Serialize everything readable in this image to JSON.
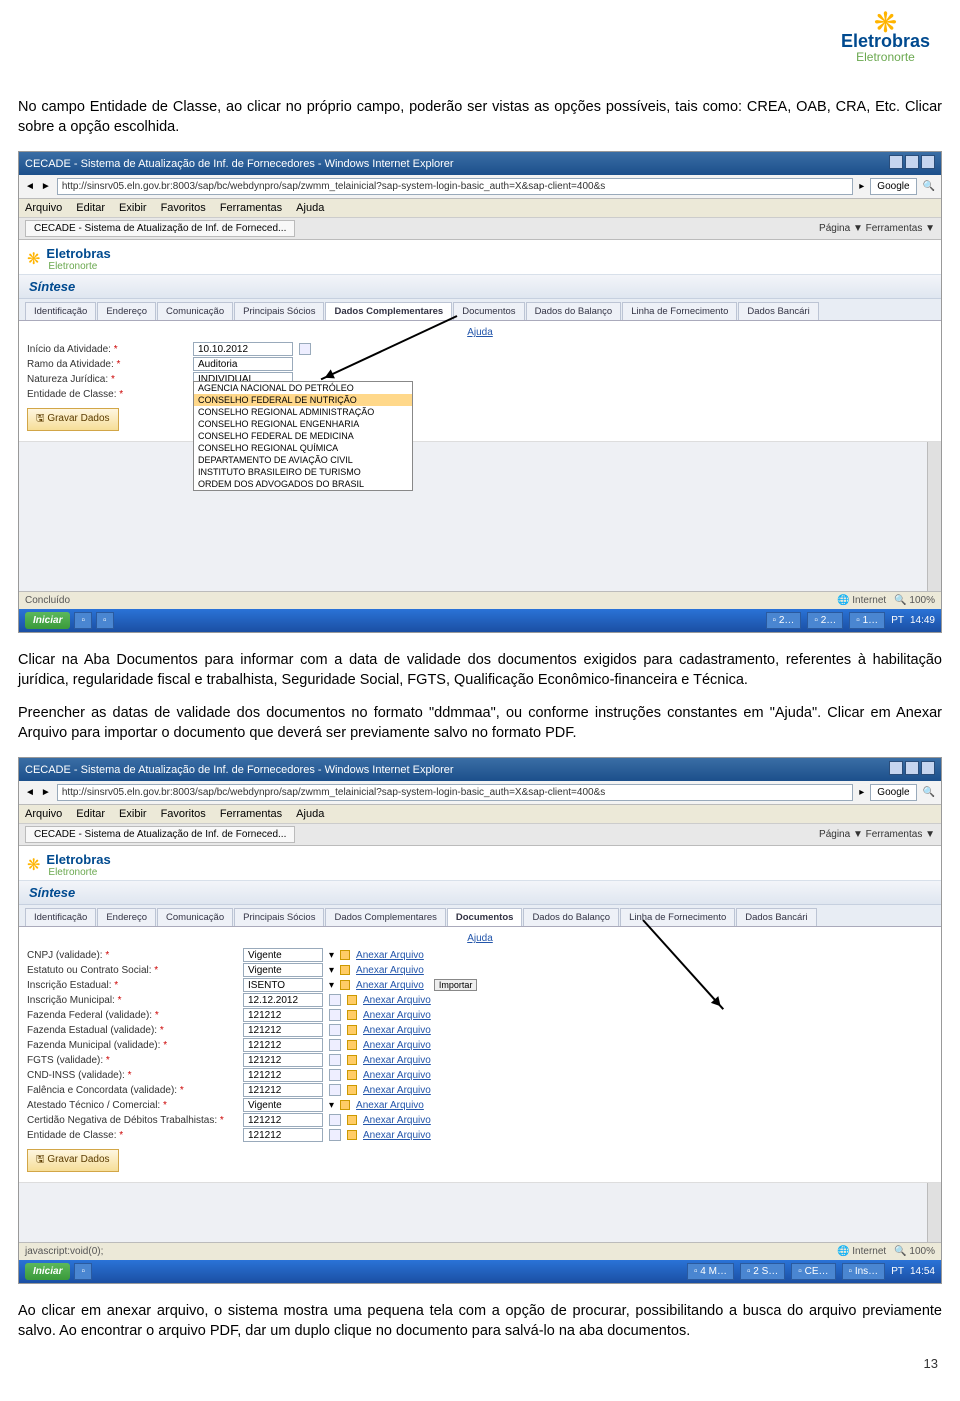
{
  "logo": {
    "brand1": "Eletrobras",
    "brand2": "Eletronorte"
  },
  "para1": "No campo Entidade de Classe, ao clicar no próprio campo, poderão ser vistas as opções possíveis, tais como: CREA, OAB, CRA, Etc. Clicar sobre a opção escolhida.",
  "para2": "Clicar na Aba Documentos para informar com a data de validade dos documentos exigidos para cadastramento, referentes à habilitação jurídica, regularidade fiscal e trabalhista, Seguridade Social, FGTS, Qualificação Econômico-financeira e Técnica.",
  "para3": "Preencher as datas de validade dos documentos no formato \"ddmmaa\", ou conforme instruções constantes em \"Ajuda\". Clicar em Anexar Arquivo para importar o documento que deverá ser previamente salvo no formato PDF.",
  "para4": "Ao clicar em anexar arquivo, o sistema mostra uma pequena tela com a opção de procurar, possibilitando a busca do arquivo previamente salvo. Ao encontrar o arquivo PDF, dar um duplo clique no documento para salvá-lo na aba documentos.",
  "window": {
    "title": "CECADE - Sistema de Atualização de Inf. de Fornecedores - Windows Internet Explorer",
    "url": "http://sinsrv05.eln.gov.br:8003/sap/bc/webdynpro/sap/zwmm_telainicial?sap-system-login-basic_auth=X&sap-client=400&s",
    "google": "Google",
    "iemenu": [
      "Arquivo",
      "Editar",
      "Exibir",
      "Favoritos",
      "Ferramentas",
      "Ajuda"
    ],
    "tab": "CECADE - Sistema de Atualização de Inf. de Forneced...",
    "pagelinks": "Página ▼   Ferramentas ▼",
    "sintese": "Síntese",
    "apptabs": [
      "Identificação",
      "Endereço",
      "Comunicação",
      "Principais Sócios",
      "Dados Complementares",
      "Documentos",
      "Dados do Balanço",
      "Linha de Fornecimento",
      "Dados Bancári"
    ],
    "ajuda": "Ajuda",
    "gravar": "Gravar Dados",
    "concluido": "Concluído",
    "internet": "Internet",
    "zoom": "100%",
    "iniciar": "Iniciar",
    "jsvoid": "javascript:void(0);",
    "anexar": "Anexar Arquivo",
    "importar": "Importar"
  },
  "s1": {
    "time": "14:49",
    "activeTab": 4,
    "rows": [
      {
        "lbl": "Início da Atividade:",
        "val": "10.10.2012",
        "cal": true
      },
      {
        "lbl": "Ramo da Atividade:",
        "val": "Auditoria"
      },
      {
        "lbl": "Natureza Jurídica:",
        "val": "INDIVIDUAL"
      },
      {
        "lbl": "Entidade de Classe:",
        "val": "CONSELHO FEDERAL DE NUTRIÇÃO",
        "wide": true
      }
    ],
    "dropdown": [
      "AGENCIA NACIONAL DO PETRÓLEO",
      "CONSELHO FEDERAL DE NUTRIÇÃO",
      "CONSELHO REGIONAL ADMINISTRAÇÃO",
      "CONSELHO REGIONAL ENGENHARIA",
      "CONSELHO FEDERAL DE MEDICINA",
      "CONSELHO REGIONAL QUÍMICA",
      "DEPARTAMENTO DE AVIAÇÃO CIVIL",
      "INSTITUTO BRASILEIRO DE TURISMO",
      "ORDEM DOS ADVOGADOS DO BRASIL"
    ],
    "ddhl": 1
  },
  "s2": {
    "time": "14:54",
    "activeTab": 5,
    "rows": [
      {
        "lbl": "CNPJ (validade):",
        "type": "sel",
        "val": "Vigente"
      },
      {
        "lbl": "Estatuto ou Contrato Social:",
        "type": "sel",
        "val": "Vigente"
      },
      {
        "lbl": "Inscrição Estadual:",
        "type": "sel",
        "val": "ISENTO",
        "imp": true
      },
      {
        "lbl": "Inscrição Municipal:",
        "type": "date",
        "val": "12.12.2012"
      },
      {
        "lbl": "Fazenda Federal (validade):",
        "type": "date",
        "val": "121212"
      },
      {
        "lbl": "Fazenda Estadual (validade):",
        "type": "date",
        "val": "121212"
      },
      {
        "lbl": "Fazenda Municipal (validade):",
        "type": "date",
        "val": "121212"
      },
      {
        "lbl": "FGTS (validade):",
        "type": "date",
        "val": "121212"
      },
      {
        "lbl": "CND-INSS (validade):",
        "type": "date",
        "val": "121212"
      },
      {
        "lbl": "Falência e Concordata (validade):",
        "type": "date",
        "val": "121212"
      },
      {
        "lbl": "Atestado Técnico / Comercial:",
        "type": "sel",
        "val": "Vigente"
      },
      {
        "lbl": "Certidão Negativa de Débitos Trabalhistas:",
        "type": "date",
        "val": "121212"
      },
      {
        "lbl": "Entidade de Classe:",
        "type": "date",
        "val": "121212"
      }
    ]
  },
  "pagenum": "13"
}
